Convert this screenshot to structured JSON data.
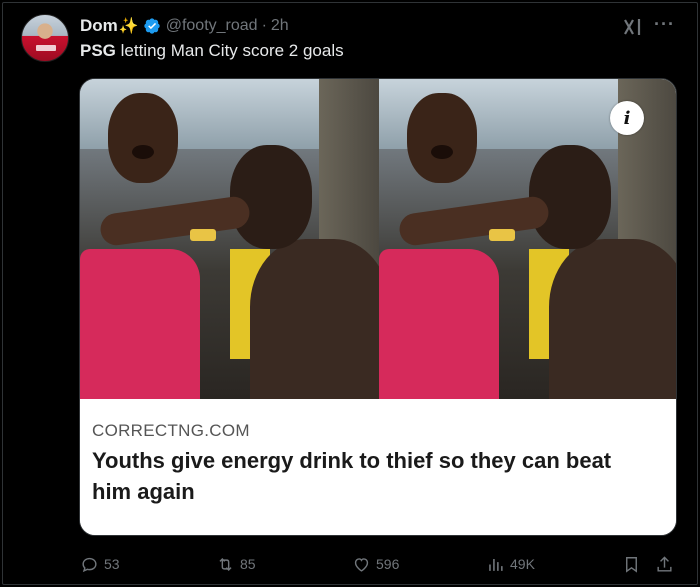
{
  "author": {
    "display_name": "Dom",
    "emoji": "✨",
    "handle": "@footy_road",
    "time": "2h"
  },
  "tweet": {
    "text_bold": "PSG",
    "text_rest": " letting Man City score 2 goals"
  },
  "media": {
    "info_glyph": "i",
    "source": "CORRECTNG.COM",
    "headline": "Youths give energy drink to thief so they can beat him again"
  },
  "actions": {
    "replies": "53",
    "reposts": "85",
    "likes": "596",
    "views": "49K"
  },
  "colors": {
    "background": "#000000",
    "text_primary": "#e7e9ea",
    "text_secondary": "#71767b",
    "verified": "#1d9bf0"
  },
  "icons": [
    "verified-badge-icon",
    "grok-icon",
    "more-icon",
    "reply-icon",
    "repost-icon",
    "like-icon",
    "views-icon",
    "bookmark-icon",
    "share-icon",
    "info-icon"
  ]
}
